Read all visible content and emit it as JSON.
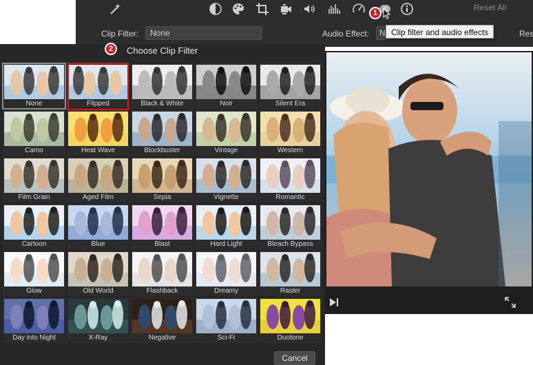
{
  "toolbar": {
    "icons": [
      "magic-wand-icon",
      "color-balance-icon",
      "color-palette-icon",
      "crop-icon",
      "camera-stabilize-icon",
      "volume-icon",
      "equalizer-icon",
      "speed-icon",
      "clip-filter-icon",
      "info-icon"
    ],
    "reset_all": "Reset All",
    "clip_filter_label": "Clip Filter:",
    "clip_filter_value": "None",
    "audio_effect_label": "Audio Effect:",
    "audio_effect_value": "N",
    "reset_label": "Res",
    "tooltip": "Clip filter and audio effects"
  },
  "badges": {
    "one": "1",
    "two": "2"
  },
  "panel": {
    "title": "Choose Clip Filter",
    "cancel": "Cancel",
    "filters": [
      "None",
      "Flipped",
      "Black & White",
      "Noir",
      "Silent Era",
      "Camo",
      "Heat Wave",
      "Blockbuster",
      "Vintage",
      "Western",
      "Film Grain",
      "Aged Film",
      "Sepia",
      "Vignette",
      "Romantic",
      "Cartoon",
      "Blue",
      "Blast",
      "Hard Light",
      "Bleach Bypass",
      "Glow",
      "Old World",
      "Flashback",
      "Dreamy",
      "Raster",
      "Day into Night",
      "X-Ray",
      "Negative",
      "Sci-Fi",
      "Duotone"
    ],
    "selected": "None",
    "highlighted": "Flipped"
  },
  "colors": {
    "toolbar_bg": "#2d2d2d",
    "panel_bg": "#272727",
    "badge_red": "#c0242a",
    "highlight_red": "#e0121a"
  }
}
